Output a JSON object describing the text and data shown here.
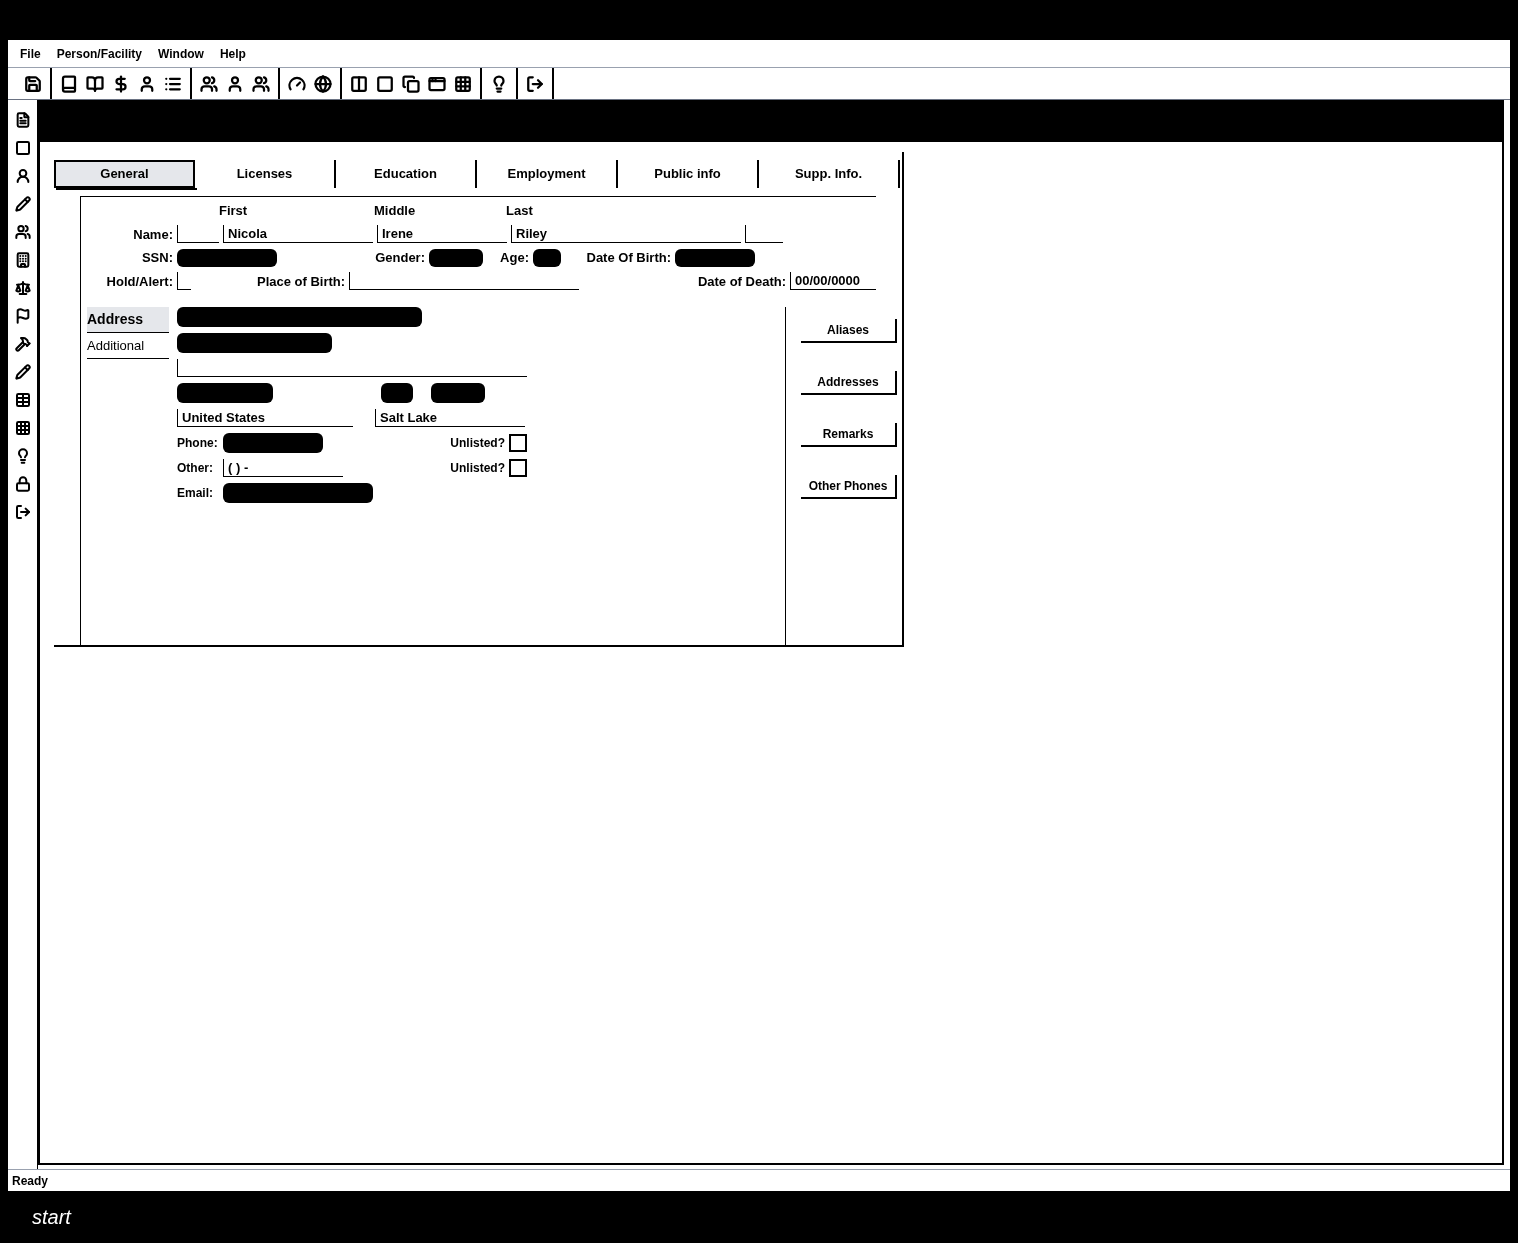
{
  "menu": [
    "File",
    "Person/Facility",
    "Window",
    "Help"
  ],
  "tabs": [
    {
      "label": "General",
      "selected": true
    },
    {
      "label": "Licenses",
      "selected": false
    },
    {
      "label": "Education",
      "selected": false
    },
    {
      "label": "Employment",
      "selected": false
    },
    {
      "label": "Public info",
      "selected": false
    },
    {
      "label": "Supp. Info.",
      "selected": false
    }
  ],
  "name": {
    "label": "Name:",
    "first_label": "First",
    "middle_label": "Middle",
    "last_label": "Last",
    "first": "Nicola",
    "middle": "Irene",
    "last": "Riley"
  },
  "row2": [
    {
      "label": "SSN:",
      "redacted": true
    },
    {
      "label": "Gender:",
      "redacted": true
    },
    {
      "label": "Age:",
      "redacted": true
    },
    {
      "label": "Date Of Birth:",
      "redacted": true
    }
  ],
  "row3": [
    {
      "label": "Hold/Alert:"
    },
    {
      "label": "Place of Birth:"
    },
    {
      "label": "Date of Death:",
      "value": "00/00/0000"
    }
  ],
  "address_tabs": [
    {
      "label": "Address",
      "selected": true
    },
    {
      "label": "Additional",
      "selected": false
    }
  ],
  "address": {
    "line1_redacted": true,
    "line2_redacted": true,
    "city_redacted": true,
    "state_redacted": true,
    "zip_redacted": true,
    "country": "United States",
    "county": "Salt Lake"
  },
  "phones": [
    {
      "label": "Phone:",
      "redacted": true,
      "unlisted_label": "Unlisted?",
      "checked": false
    },
    {
      "label": "Other:",
      "value": "( ) -",
      "unlisted_label": "Unlisted?",
      "checked": false
    }
  ],
  "email": {
    "label": "Email:",
    "redacted": true
  },
  "buttons": [
    "Aliases",
    "Addresses",
    "Remarks",
    "Other Phones"
  ],
  "status_bar": "Ready",
  "taskbar": {
    "start": "start"
  }
}
